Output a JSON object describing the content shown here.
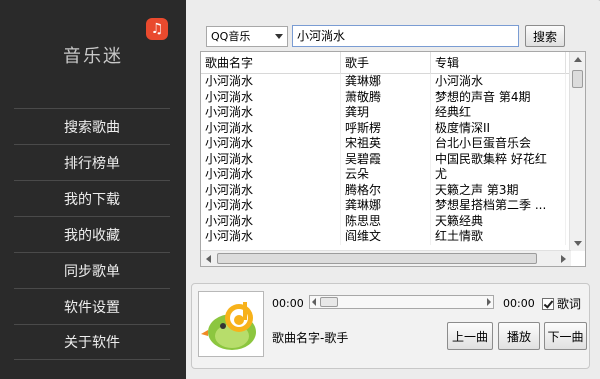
{
  "app": {
    "title": "音乐迷",
    "logo_glyph": "♫",
    "colors": {
      "sidebar": "#2a2a2a",
      "logo": "#e94a2e"
    }
  },
  "sidebar": {
    "items": [
      {
        "label": "搜索歌曲"
      },
      {
        "label": "排行榜单"
      },
      {
        "label": "我的下载"
      },
      {
        "label": "我的收藏"
      },
      {
        "label": "同步歌单"
      },
      {
        "label": "软件设置"
      },
      {
        "label": "关于软件"
      }
    ]
  },
  "search": {
    "source_selected": "QQ音乐",
    "query": "小河淌水",
    "button_label": "搜索"
  },
  "results": {
    "columns": [
      "歌曲名字",
      "歌手",
      "专辑"
    ],
    "rows": [
      [
        "小河淌水",
        "龚琳娜",
        "小河淌水"
      ],
      [
        "小河淌水",
        "萧敬腾",
        "梦想的声音 第4期"
      ],
      [
        "小河淌水",
        "龚玥",
        "经典红"
      ],
      [
        "小河淌水",
        "呼斯楞",
        "极度情深II"
      ],
      [
        "小河淌水",
        "宋祖英",
        "台北小巨蛋音乐会"
      ],
      [
        "小河淌水",
        "吴碧霞",
        "中国民歌集粹 好花红"
      ],
      [
        "小河淌水",
        "云朵",
        "尤"
      ],
      [
        "小河淌水",
        "腾格尔",
        "天籁之声 第3期"
      ],
      [
        "小河淌水",
        "龚琳娜",
        "梦想星搭档第二季 ..."
      ],
      [
        "小河淌水",
        "陈思思",
        "天籁经典"
      ],
      [
        "小河淌水",
        "阎维文",
        "红土情歌"
      ]
    ]
  },
  "player": {
    "time_current": "00:00",
    "time_total": "00:00",
    "lyrics_label": "歌词",
    "lyrics_checked": true,
    "now_playing": "歌曲名字-歌手",
    "prev_label": "上一曲",
    "play_label": "播放",
    "next_label": "下一曲"
  }
}
